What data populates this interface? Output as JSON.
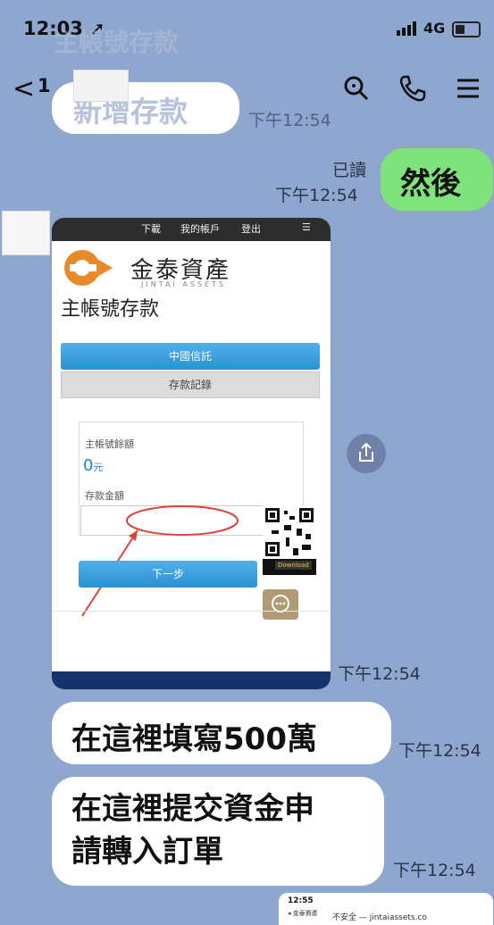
{
  "status_bar": {
    "time": "12:03",
    "network": "4G"
  },
  "header": {
    "back_symbol": "<",
    "unread_count": "1"
  },
  "faded_messages": [
    "主帳號存款",
    "新增存款"
  ],
  "messages": [
    {
      "side": "right",
      "read_label": "已讀",
      "time": "下午12:54",
      "text": "然後"
    },
    {
      "side": "left",
      "time": "下午12:54",
      "type": "image"
    },
    {
      "side": "left",
      "time": "下午12:54",
      "text": "在這裡填寫500萬"
    },
    {
      "side": "left",
      "time": "下午12:54",
      "text_lines": [
        "在這裡提交資金申",
        "請轉入訂單"
      ]
    }
  ],
  "partial_time_top": "下午12:54",
  "screenshot": {
    "nav": [
      "下載",
      "我的帳戶",
      "登出",
      "☰"
    ],
    "brand_cn": "金泰資產",
    "brand_en": "JINTAI ASSETS",
    "page_title": "主帳號存款",
    "bank_button": "中國信託",
    "records_button": "存款記錄",
    "balance_label": "主帳號餘額",
    "balance_value": "0",
    "balance_unit": "元",
    "amount_label": "存款金額",
    "next_button": "下一步",
    "download_label": "Download"
  },
  "bottom_preview": {
    "time": "12:55",
    "back_text": "◂ 金泰資產",
    "url": "不安全 — jintaiassets.co"
  },
  "colors": {
    "background": "#8fa7cf",
    "green_bubble": "#7fe37c",
    "brand_orange": "#e8892c",
    "footer_navy": "#16326b"
  }
}
